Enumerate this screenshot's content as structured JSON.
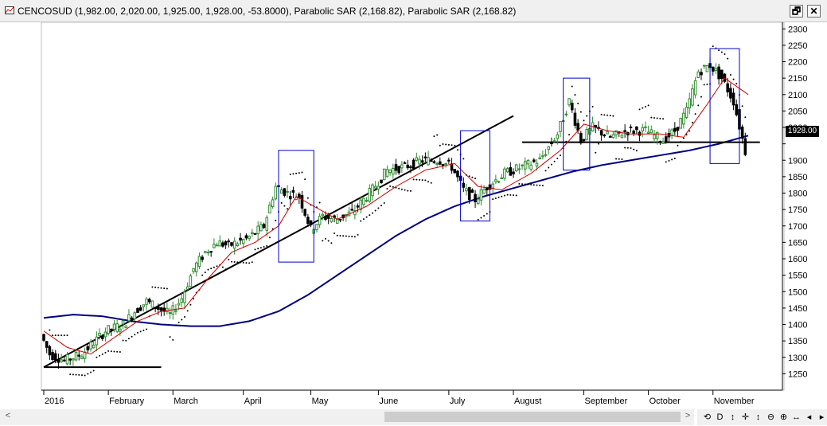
{
  "window": {
    "title": "CENCOSUD (1,982.00, 2,020.00, 1,925.00, 1,928.00, -53.8000), Parabolic SAR (2,168.82), Parabolic SAR (2,168.82)",
    "restore_label": "🗗",
    "close_label": "✕"
  },
  "chart_data": {
    "type": "candlestick",
    "symbol": "CENCOSUD",
    "last": {
      "open": 1982.0,
      "high": 2020.0,
      "low": 1925.0,
      "close": 1928.0,
      "change": -53.8
    },
    "indicators": [
      "Parabolic SAR (2,168.82)",
      "Parabolic SAR (2,168.82)"
    ],
    "current_price_label": "1928.00",
    "ylim": [
      1200,
      2320
    ],
    "y_ticks": [
      1250,
      1300,
      1350,
      1400,
      1450,
      1500,
      1550,
      1600,
      1650,
      1700,
      1750,
      1800,
      1850,
      1900,
      1950,
      2000,
      2050,
      2100,
      2150,
      2200,
      2250,
      2300
    ],
    "y_tick_labels": [
      "1250",
      "1300",
      "1350",
      "1400",
      "1450",
      "1500",
      "1550",
      "1600",
      "1650",
      "1700",
      "1750",
      "1800",
      "1850",
      "1900",
      "",
      "2000",
      "2050",
      "2100",
      "2150",
      "2200",
      "2250",
      "2300"
    ],
    "x_months": [
      {
        "label": "2016",
        "day": 0
      },
      {
        "label": "February",
        "day": 22
      },
      {
        "label": "March",
        "day": 44
      },
      {
        "label": "April",
        "day": 68
      },
      {
        "label": "May",
        "day": 91
      },
      {
        "label": "June",
        "day": 114
      },
      {
        "label": "July",
        "day": 138
      },
      {
        "label": "August",
        "day": 160
      },
      {
        "label": "September",
        "day": 184
      },
      {
        "label": "October",
        "day": 206
      },
      {
        "label": "November",
        "day": 228
      }
    ],
    "n_days": 240,
    "price_path": [
      [
        0,
        1370
      ],
      [
        3,
        1310
      ],
      [
        8,
        1290
      ],
      [
        14,
        1310
      ],
      [
        22,
        1380
      ],
      [
        28,
        1400
      ],
      [
        32,
        1440
      ],
      [
        36,
        1470
      ],
      [
        40,
        1450
      ],
      [
        44,
        1430
      ],
      [
        48,
        1480
      ],
      [
        52,
        1570
      ],
      [
        56,
        1620
      ],
      [
        60,
        1650
      ],
      [
        64,
        1640
      ],
      [
        70,
        1660
      ],
      [
        76,
        1700
      ],
      [
        80,
        1820
      ],
      [
        84,
        1800
      ],
      [
        88,
        1790
      ],
      [
        92,
        1690
      ],
      [
        96,
        1730
      ],
      [
        100,
        1720
      ],
      [
        106,
        1740
      ],
      [
        112,
        1800
      ],
      [
        118,
        1870
      ],
      [
        124,
        1880
      ],
      [
        130,
        1900
      ],
      [
        136,
        1900
      ],
      [
        140,
        1880
      ],
      [
        144,
        1810
      ],
      [
        148,
        1780
      ],
      [
        152,
        1820
      ],
      [
        158,
        1860
      ],
      [
        164,
        1880
      ],
      [
        170,
        1900
      ],
      [
        176,
        1980
      ],
      [
        180,
        2080
      ],
      [
        184,
        1960
      ],
      [
        188,
        2000
      ],
      [
        194,
        1970
      ],
      [
        200,
        1990
      ],
      [
        206,
        1990
      ],
      [
        212,
        1960
      ],
      [
        216,
        1990
      ],
      [
        220,
        2050
      ],
      [
        224,
        2170
      ],
      [
        228,
        2190
      ],
      [
        232,
        2150
      ],
      [
        236,
        2080
      ],
      [
        240,
        1928
      ]
    ],
    "ma_short_path": [
      [
        0,
        1380
      ],
      [
        8,
        1330
      ],
      [
        16,
        1310
      ],
      [
        24,
        1360
      ],
      [
        32,
        1410
      ],
      [
        40,
        1440
      ],
      [
        48,
        1450
      ],
      [
        56,
        1540
      ],
      [
        64,
        1620
      ],
      [
        72,
        1650
      ],
      [
        80,
        1700
      ],
      [
        86,
        1790
      ],
      [
        92,
        1760
      ],
      [
        100,
        1720
      ],
      [
        110,
        1760
      ],
      [
        120,
        1820
      ],
      [
        130,
        1870
      ],
      [
        140,
        1890
      ],
      [
        148,
        1820
      ],
      [
        156,
        1810
      ],
      [
        166,
        1860
      ],
      [
        176,
        1930
      ],
      [
        184,
        2010
      ],
      [
        192,
        1990
      ],
      [
        200,
        1980
      ],
      [
        210,
        1980
      ],
      [
        218,
        1970
      ],
      [
        226,
        2070
      ],
      [
        232,
        2150
      ],
      [
        240,
        2100
      ]
    ],
    "ma_long_path": [
      [
        0,
        1420
      ],
      [
        10,
        1430
      ],
      [
        20,
        1425
      ],
      [
        30,
        1410
      ],
      [
        40,
        1400
      ],
      [
        50,
        1395
      ],
      [
        60,
        1395
      ],
      [
        70,
        1410
      ],
      [
        80,
        1440
      ],
      [
        90,
        1490
      ],
      [
        100,
        1550
      ],
      [
        110,
        1610
      ],
      [
        120,
        1670
      ],
      [
        130,
        1720
      ],
      [
        140,
        1760
      ],
      [
        150,
        1790
      ],
      [
        160,
        1815
      ],
      [
        170,
        1840
      ],
      [
        180,
        1865
      ],
      [
        190,
        1885
      ],
      [
        200,
        1900
      ],
      [
        210,
        1915
      ],
      [
        220,
        1930
      ],
      [
        230,
        1950
      ],
      [
        240,
        1975
      ]
    ],
    "trendlines": [
      {
        "from": [
          0,
          1270
        ],
        "to": [
          40,
          1270
        ]
      },
      {
        "from": [
          0,
          1270
        ],
        "to": [
          160,
          2035
        ]
      },
      {
        "from": [
          163,
          1955
        ],
        "to": [
          244,
          1955
        ]
      }
    ],
    "highlight_boxes": [
      {
        "d0": 80,
        "d1": 92,
        "p_top": 1930,
        "p_bot": 1590
      },
      {
        "d0": 142,
        "d1": 152,
        "p_top": 1990,
        "p_bot": 1715
      },
      {
        "d0": 177,
        "d1": 186,
        "p_top": 2150,
        "p_bot": 1870
      },
      {
        "d0": 227,
        "d1": 237,
        "p_top": 2240,
        "p_bot": 1890
      }
    ],
    "colors": {
      "up_candle": "#2e8b2e",
      "down_candle": "#000000",
      "ma_short": "#d10000",
      "ma_long": "#000080",
      "sar": "#000000",
      "trend": "#000000",
      "box": "#0000cc"
    }
  },
  "toolbar": {
    "tools": [
      "⟲",
      "D",
      "↕",
      "✛",
      "↕",
      "⊖",
      "⊕",
      "↔",
      "◂",
      "▸"
    ],
    "scroll_left": "<",
    "scroll_right": ">"
  }
}
